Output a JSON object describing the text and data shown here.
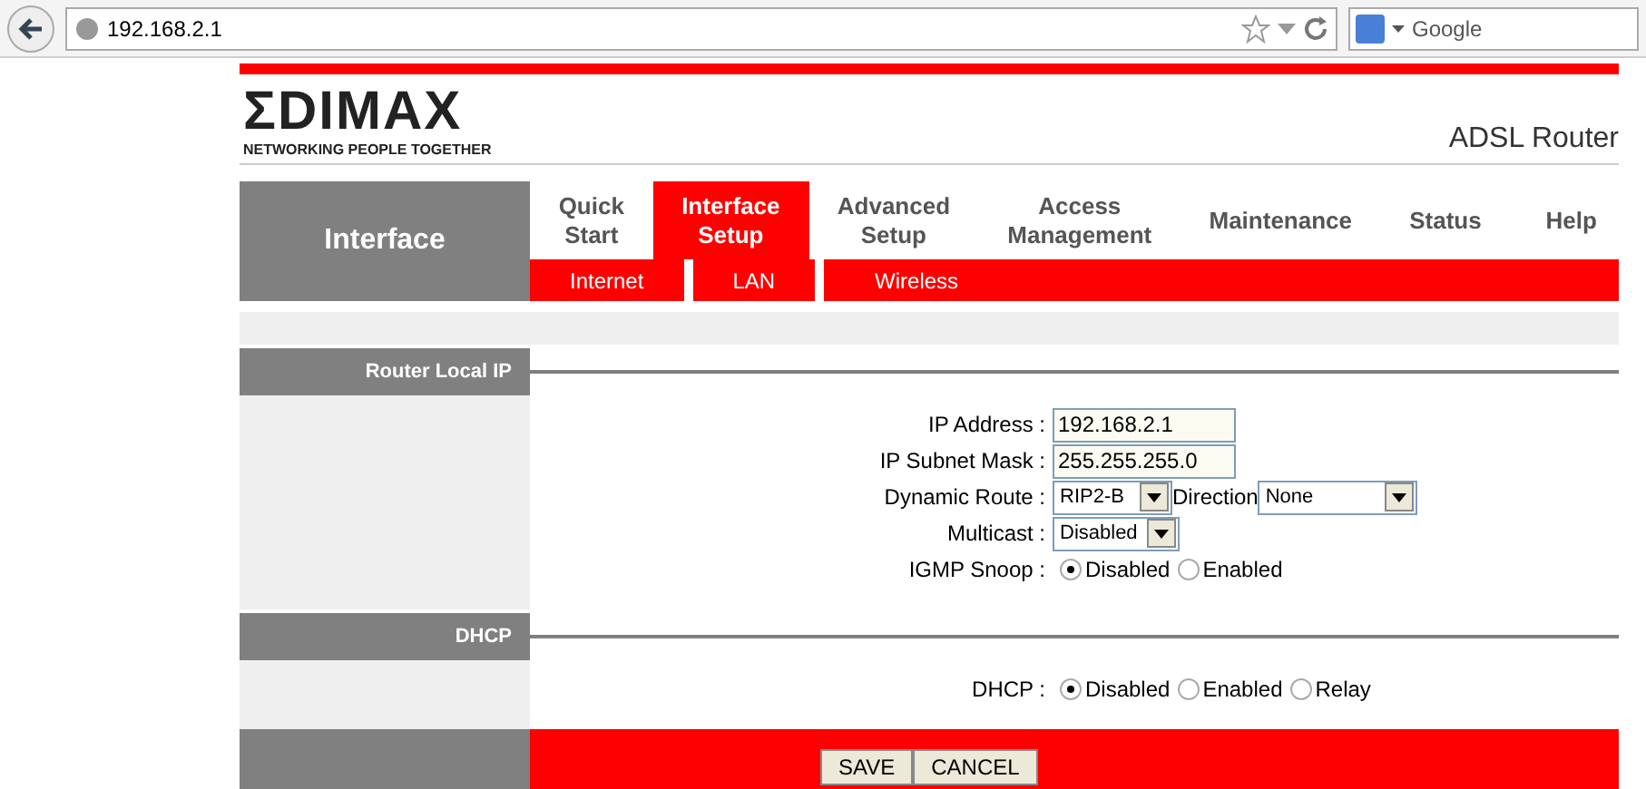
{
  "browser": {
    "url": "192.168.2.1",
    "search_placeholder": "Google"
  },
  "header": {
    "logo": "ΣDIMAX",
    "tagline": "NETWORKING PEOPLE TOGETHER",
    "product": "ADSL Router"
  },
  "section_title": "Interface",
  "tabs": [
    {
      "label": "Quick\nStart",
      "selected": false
    },
    {
      "label": "Interface\nSetup",
      "selected": true
    },
    {
      "label": "Advanced\nSetup",
      "selected": false
    },
    {
      "label": "Access\nManagement",
      "selected": false
    },
    {
      "label": "Maintenance",
      "selected": false
    },
    {
      "label": "Status",
      "selected": false
    },
    {
      "label": "Help",
      "selected": false
    }
  ],
  "subtabs": [
    {
      "label": "Internet",
      "selected": false
    },
    {
      "label": "LAN",
      "selected": false
    },
    {
      "label": "Wireless",
      "selected": false
    }
  ],
  "sections": [
    {
      "title": "Router Local IP",
      "rows": [
        {
          "kind": "text",
          "label": "IP Address :",
          "value": "192.168.2.1"
        },
        {
          "kind": "text",
          "label": "IP Subnet Mask :",
          "value": "255.255.255.0"
        },
        {
          "kind": "select2",
          "label": "Dynamic Route :",
          "value": "RIP2-B",
          "label2": "Direction",
          "value2": "None"
        },
        {
          "kind": "select",
          "label": "Multicast :",
          "value": "Disabled"
        },
        {
          "kind": "radio",
          "label": "IGMP Snoop :",
          "options": [
            {
              "label": "Disabled",
              "selected": true
            },
            {
              "label": "Enabled",
              "selected": false
            }
          ]
        }
      ]
    },
    {
      "title": "DHCP",
      "rows": [
        {
          "kind": "radio",
          "label": "DHCP :",
          "options": [
            {
              "label": "Disabled",
              "selected": true
            },
            {
              "label": "Enabled",
              "selected": false
            },
            {
              "label": "Relay",
              "selected": false
            }
          ]
        }
      ]
    }
  ],
  "buttons": [
    "SAVE",
    "CANCEL"
  ]
}
